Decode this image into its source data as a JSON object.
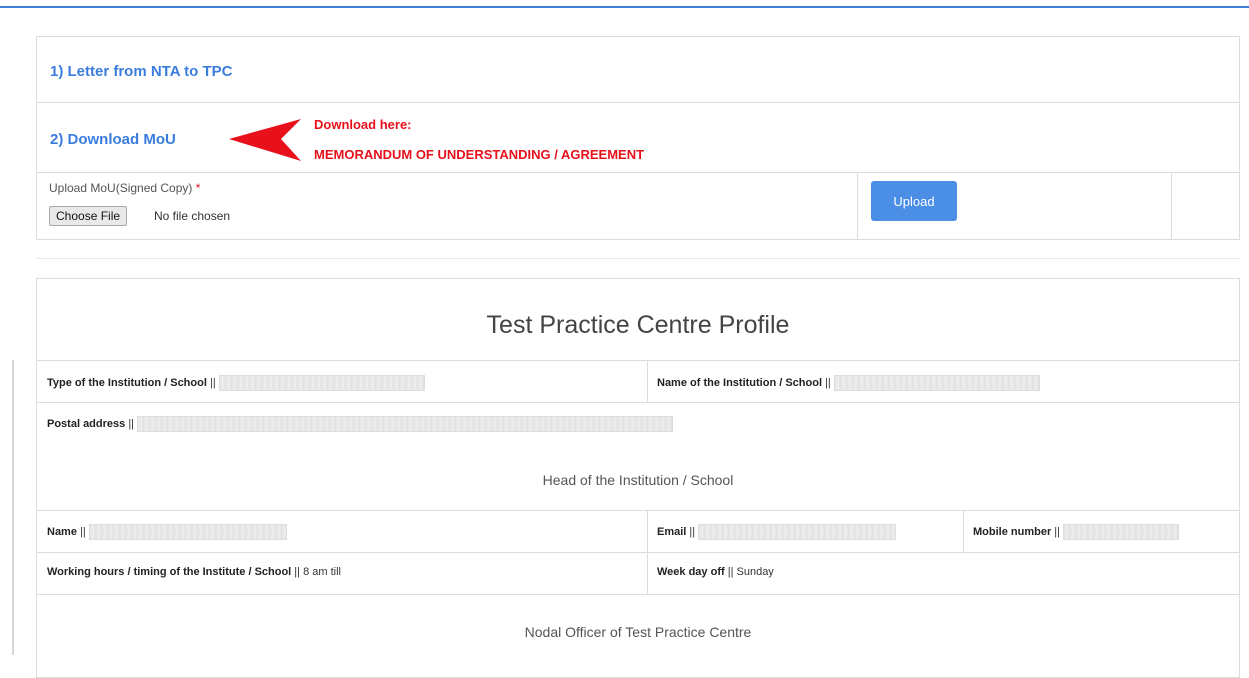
{
  "mou": {
    "letter_link": "1) Letter from NTA to TPC",
    "download_link": "2) Download MoU",
    "download_here": "Download here:",
    "memorandum": "MEMORANDUM OF UNDERSTANDING / AGREEMENT",
    "upload_label": "Upload MoU(Signed Copy)",
    "required_mark": "*",
    "choose_file": "Choose File",
    "file_status": "No file chosen",
    "upload_button": "Upload"
  },
  "colors": {
    "accent": "#3b7ddd",
    "alert_red": "#e8101a",
    "button_blue": "#4a8ee6"
  },
  "profile": {
    "title": "Test Practice Centre Profile",
    "type_label": "Type of the Institution / School",
    "name_inst_label": "Name of the Institution / School",
    "postal_label": "Postal address",
    "head_section": "Head of the Institution / School",
    "name_label": "Name",
    "email_label": "Email",
    "mobile_label": "Mobile number",
    "working_label": "Working hours / timing of the Institute / School",
    "working_value": "8 am till",
    "weekoff_label": "Week day off",
    "weekoff_value": "Sunday",
    "nodal_section": "Nodal Officer of Test Practice Centre",
    "separator": "||"
  }
}
